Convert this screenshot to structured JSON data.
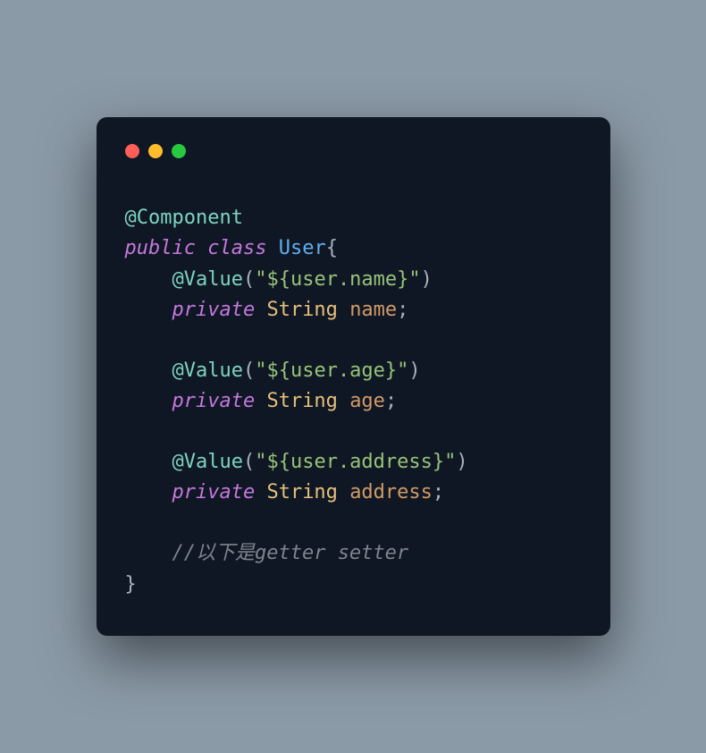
{
  "code": {
    "annotation_component": "@Component",
    "keyword_public": "public",
    "keyword_class": "class",
    "class_name": "User",
    "brace_open": "{",
    "brace_close": "}",
    "annotation_value": "@Value",
    "paren_open": "(",
    "paren_close": ")",
    "keyword_private": "private",
    "type_string": "String",
    "semicolon": ";",
    "quote": "\"",
    "value_name": "${user.name}",
    "value_age": "${user.age}",
    "value_address": "${user.address}",
    "field_name": "name",
    "field_age": "age",
    "field_address": "address",
    "comment": "//以下是getter setter",
    "indent1": "    ",
    "indent2": "    ",
    "space": " "
  }
}
